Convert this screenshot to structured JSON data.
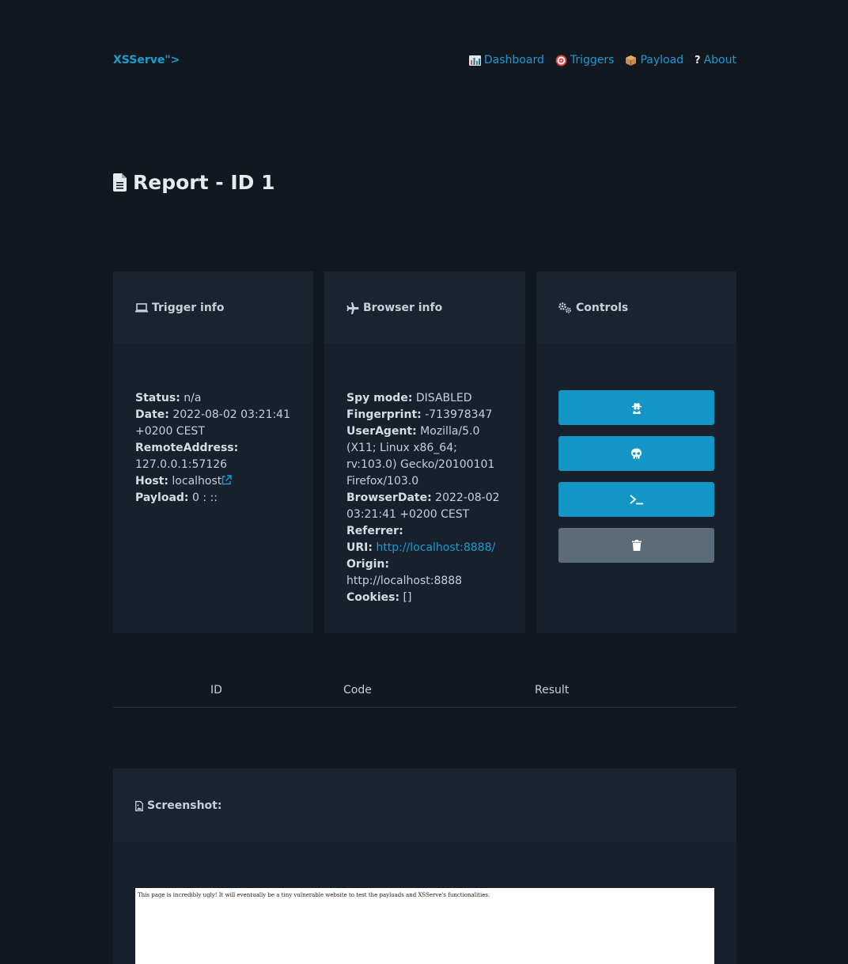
{
  "nav": {
    "brand": "XSServe\">",
    "links": [
      {
        "icon": "bar-chart-icon",
        "label": "Dashboard"
      },
      {
        "icon": "target-icon",
        "label": "Triggers"
      },
      {
        "icon": "package-icon",
        "label": "Payload"
      },
      {
        "icon": "question-icon",
        "label": "About"
      }
    ]
  },
  "page": {
    "title": "Report - ID 1"
  },
  "trigger": {
    "header": "Trigger info",
    "status_label": "Status:",
    "status": "n/a",
    "date_label": "Date:",
    "date": "2022-08-02 03:21:41 +0200 CEST",
    "remote_label": "RemoteAddress:",
    "remote": "127.0.0.1:57126",
    "host_label": "Host:",
    "host": "localhost",
    "payload_label": "Payload:",
    "payload": "0 : ::"
  },
  "browser": {
    "header": "Browser info",
    "spy_label": "Spy mode:",
    "spy": "DISABLED",
    "fp_label": "Fingerprint:",
    "fp": "-713978347",
    "ua_label": "UserAgent:",
    "ua": "Mozilla/5.0 (X11; Linux x86_64; rv:103.0) Gecko/20100101 Firefox/103.0",
    "bdate_label": "BrowserDate:",
    "bdate": "2022-08-02 03:21:41 +0200 CEST",
    "ref_label": "Referrer:",
    "ref": "",
    "uri_label": "URI:",
    "uri": "http://localhost:8888/",
    "origin_label": "Origin:",
    "origin": "http://localhost:8888",
    "cookies_label": "Cookies:",
    "cookies": "[]"
  },
  "controls": {
    "header": "Controls",
    "buttons": [
      {
        "icon": "spy-icon",
        "color": "#1395c5"
      },
      {
        "icon": "skull-icon",
        "color": "#1395c5"
      },
      {
        "icon": "terminal-icon",
        "color": "#1395c5"
      },
      {
        "icon": "trash-icon",
        "color": "#5c6b79"
      }
    ]
  },
  "table": {
    "columns": [
      "ID",
      "Code",
      "Result"
    ]
  },
  "screenshot": {
    "header": "Screenshot:",
    "page_text": "This page is incredibly ugly! It will eventually be a tiny vulnerable website to test the payloads and XSServe's functionalities."
  },
  "colors": {
    "accent": "#1c9bcf",
    "bg": "#11181f",
    "card": "#18212b"
  }
}
